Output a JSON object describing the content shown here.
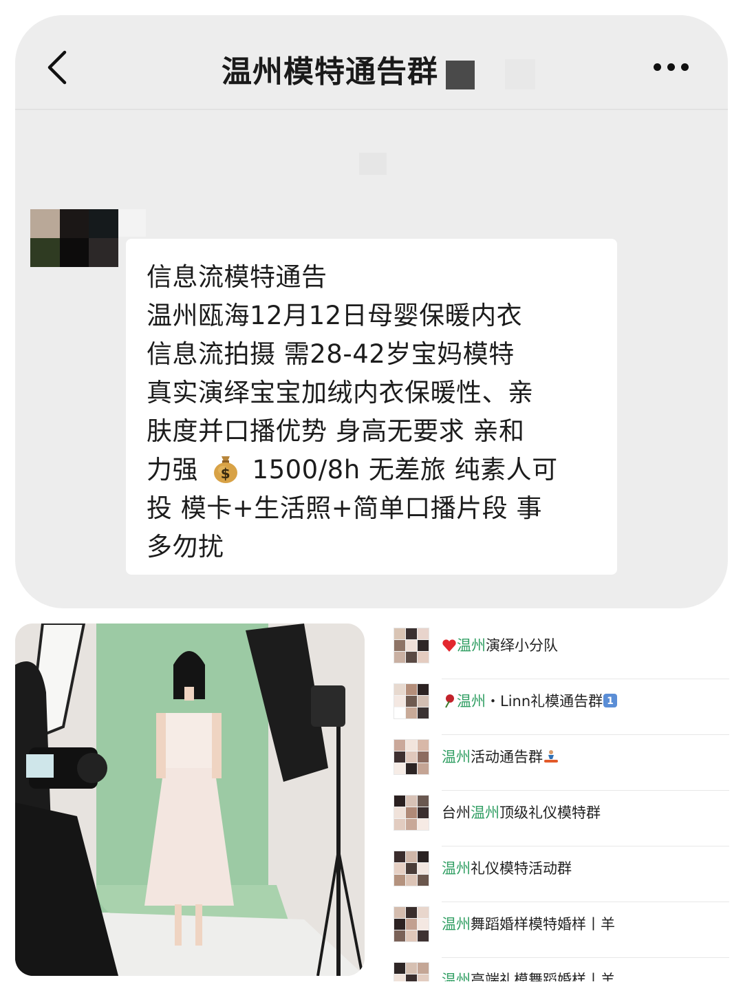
{
  "chat": {
    "title": "温州模特通告群",
    "message_lines": [
      "信息流模特通告",
      "温州瓯海12月12日母婴保暖内衣",
      "信息流拍摄 需28-42岁宝妈模特",
      "真实演绎宝宝加绒内衣保暖性、亲",
      "肤度并口播优势 身高无要求 亲和",
      "力强",
      "1500/8h 无差旅 纯素人可",
      "投  模卡+生活照+简单口播片段 事",
      "多勿扰"
    ]
  },
  "icons": {
    "back": "chevron-left-icon",
    "more": "more-dots-icon",
    "money": "money-bag-icon"
  },
  "groups": [
    {
      "prefix": "",
      "highlight": "温州",
      "suffix": "演绎小分队",
      "emoji_before": "heart-icon",
      "emoji_after": ""
    },
    {
      "prefix": "",
      "highlight": "温州",
      "suffix": "・Linn礼模通告群",
      "emoji_before": "rose-icon",
      "emoji_after": "keycap-one-icon"
    },
    {
      "prefix": "",
      "highlight": "温州",
      "suffix": "活动通告群",
      "emoji_before": "",
      "emoji_after": "snowboarder-icon"
    },
    {
      "prefix": "台州",
      "highlight": "温州",
      "suffix": "顶级礼仪模特群",
      "emoji_before": "",
      "emoji_after": ""
    },
    {
      "prefix": "",
      "highlight": "温州",
      "suffix": "礼仪模特活动群",
      "emoji_before": "",
      "emoji_after": ""
    },
    {
      "prefix": "",
      "highlight": "温州",
      "suffix": "舞蹈婚样模特婚样丨羊",
      "emoji_before": "",
      "emoji_after": ""
    },
    {
      "prefix": "",
      "highlight": "温州",
      "suffix": "高端礼模舞蹈婚样丨羊",
      "emoji_before": "",
      "emoji_after": ""
    }
  ],
  "colors": {
    "highlight": "#2f9e62",
    "chat_background": "#ededed",
    "bubble": "#ffffff"
  }
}
